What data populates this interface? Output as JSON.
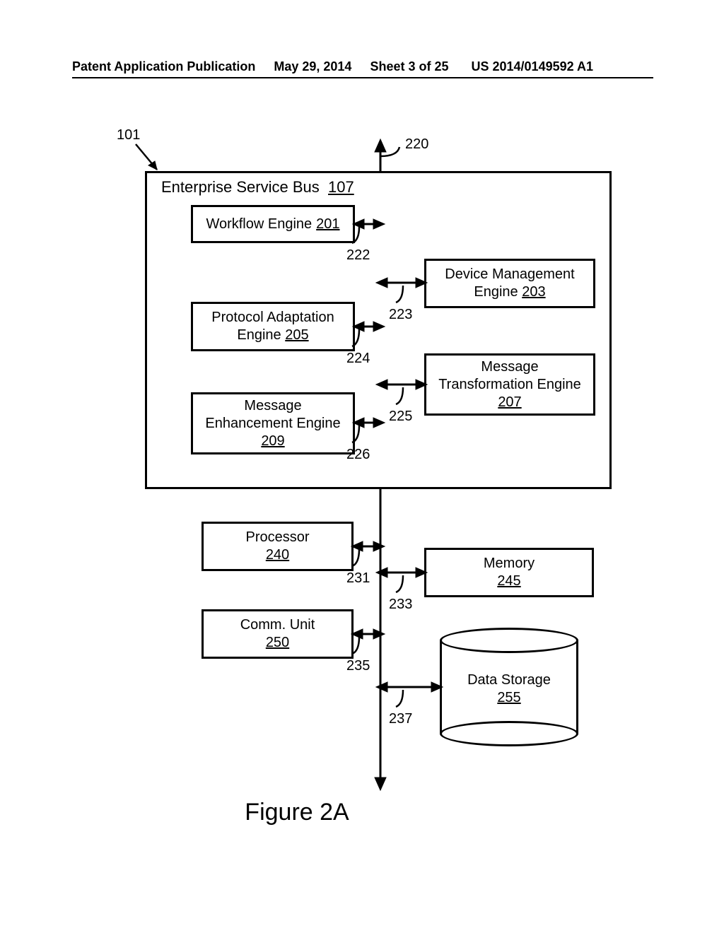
{
  "header": {
    "pub_type": "Patent Application Publication",
    "date": "May 29, 2014",
    "sheet": "Sheet 3 of 25",
    "pub_number": "US 2014/0149592 A1"
  },
  "overall_ref": "101",
  "bus_ref": "220",
  "esb": {
    "title": "Enterprise Service Bus",
    "ref": "107",
    "workflow": {
      "label": "Workflow Engine",
      "ref": "201",
      "bus_ref": "222"
    },
    "devmgmt": {
      "label": "Device Management\nEngine",
      "ref": "203",
      "bus_ref": "223"
    },
    "protadapt": {
      "label": "Protocol Adaptation\nEngine",
      "ref": "205",
      "bus_ref": "224"
    },
    "msgtrans": {
      "label": "Message\nTransformation Engine",
      "ref": "207",
      "bus_ref": "225"
    },
    "msgenh": {
      "label": "Message\nEnhancement Engine",
      "ref": "209",
      "bus_ref": "226"
    }
  },
  "hw": {
    "processor": {
      "label": "Processor",
      "ref": "240",
      "bus_ref": "231"
    },
    "memory": {
      "label": "Memory",
      "ref": "245",
      "bus_ref": "233"
    },
    "comm": {
      "label": "Comm. Unit",
      "ref": "250",
      "bus_ref": "235"
    },
    "storage": {
      "label": "Data Storage",
      "ref": "255",
      "bus_ref": "237"
    }
  },
  "figure_caption": "Figure 2A"
}
